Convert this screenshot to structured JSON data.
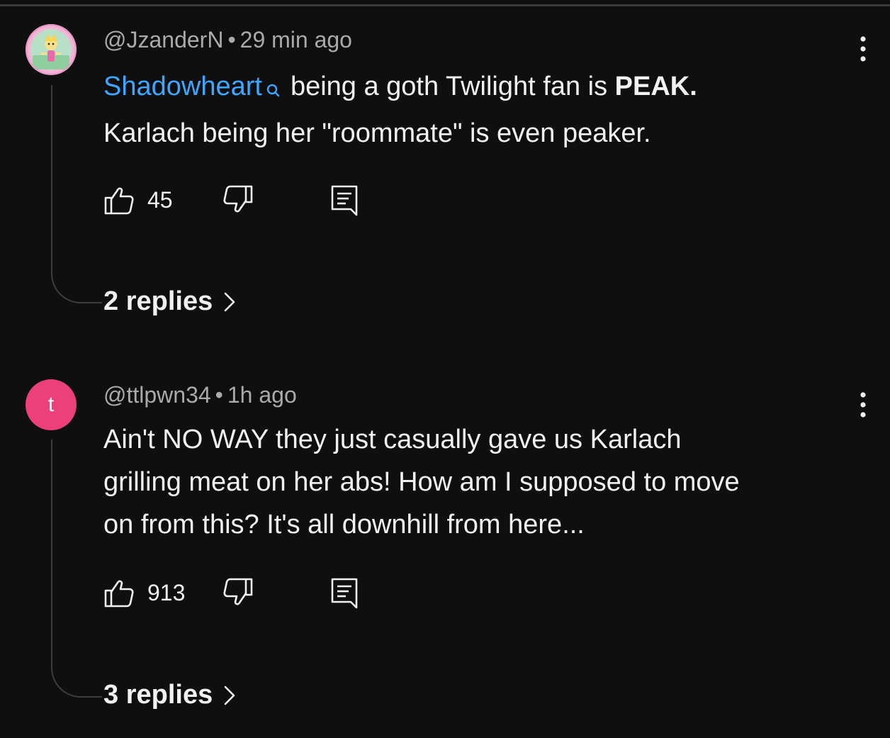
{
  "comments": [
    {
      "handle": "@JzanderN",
      "separator": "•",
      "time": "29 min ago",
      "mention": "Shadowheart",
      "line1_rest": "being a goth Twilight fan is ",
      "line1_bold": "PEAK.",
      "line2": "Karlach being her \"roommate\" is even peaker.",
      "likes": "45",
      "replies_label": "2 replies",
      "avatar": {
        "icon": "profile-picture-cartoon"
      }
    },
    {
      "handle": "@ttlpwn34",
      "separator": "•",
      "time": "1h ago",
      "lines": [
        "Ain't NO WAY they just casually gave us Karlach",
        "grilling meat on her abs! How am I supposed to move",
        "on from this? It's all downhill from here..."
      ],
      "likes": "913",
      "replies_label": "3 replies",
      "avatar": {
        "letter": "t",
        "color": "#ec407a"
      }
    }
  ],
  "icons": {
    "like": "thumbs-up-icon",
    "dislike": "thumbs-down-icon",
    "reply": "comment-reply-icon",
    "more": "more-vertical-icon",
    "chevron": "chevron-right-icon",
    "search": "search-icon"
  },
  "colors": {
    "background": "#0f0f0f",
    "text": "#f1f1f1",
    "secondary": "#aaaaaa",
    "link": "#3ea6ff",
    "avatar_t": "#ec407a"
  }
}
